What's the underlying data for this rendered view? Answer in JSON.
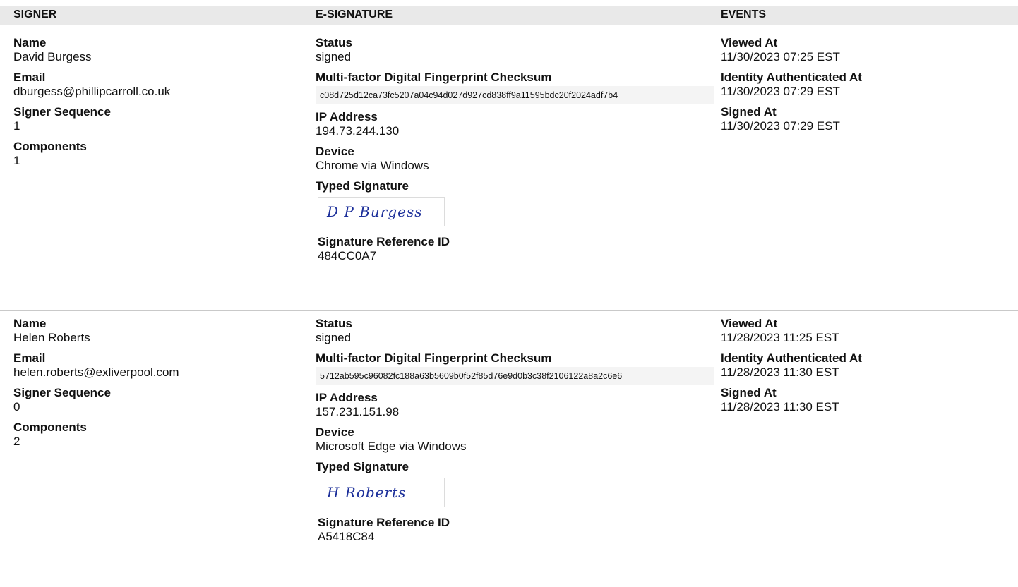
{
  "header": {
    "signer": "SIGNER",
    "esignature": "E-SIGNATURE",
    "events": "EVENTS"
  },
  "labels": {
    "name": "Name",
    "email": "Email",
    "signer_sequence": "Signer Sequence",
    "components": "Components",
    "status": "Status",
    "checksum": "Multi-factor Digital Fingerprint Checksum",
    "ip_address": "IP Address",
    "device": "Device",
    "typed_signature": "Typed Signature",
    "signature_reference_id": "Signature Reference ID",
    "viewed_at": "Viewed At",
    "identity_authenticated_at": "Identity Authenticated At",
    "signed_at": "Signed At"
  },
  "signers": [
    {
      "name": "David Burgess",
      "email": "dburgess@phillipcarroll.co.uk",
      "signer_sequence": "1",
      "components": "1",
      "status": "signed",
      "checksum": "c08d725d12ca73fc5207a04c94d027d927cd838ff9a11595bdc20f2024adf7b4",
      "ip_address": "194.73.244.130",
      "device": "Chrome via Windows",
      "typed_signature": "D P Burgess",
      "signature_reference_id": "484CC0A7",
      "viewed_at": "11/30/2023 07:25 EST",
      "identity_authenticated_at": "11/30/2023 07:29 EST",
      "signed_at": "11/30/2023 07:29 EST"
    },
    {
      "name": "Helen Roberts",
      "email": "helen.roberts@exliverpool.com",
      "signer_sequence": "0",
      "components": "2",
      "status": "signed",
      "checksum": "5712ab595c96082fc188a63b5609b0f52f85d76e9d0b3c38f2106122a8a2c6e6",
      "ip_address": "157.231.151.98",
      "device": "Microsoft Edge via Windows",
      "typed_signature": "H Roberts",
      "signature_reference_id": "A5418C84",
      "viewed_at": "11/28/2023 11:25 EST",
      "identity_authenticated_at": "11/28/2023 11:30 EST",
      "signed_at": "11/28/2023 11:30 EST"
    }
  ]
}
